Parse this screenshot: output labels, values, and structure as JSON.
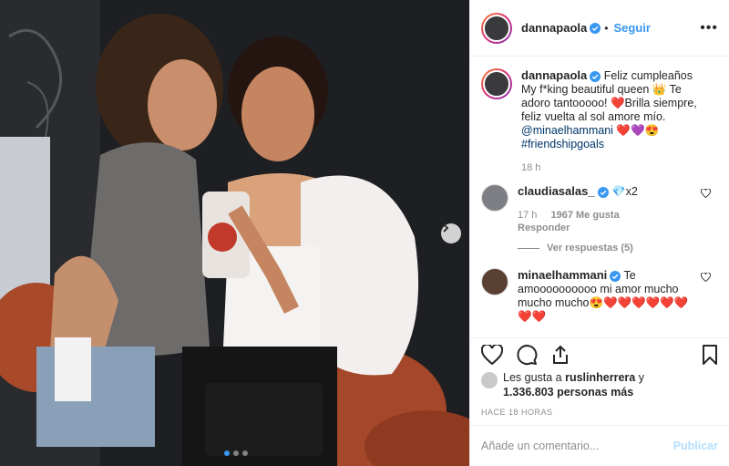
{
  "post": {
    "author": "dannapaola",
    "follow_label": "Seguir",
    "more_label": "•••",
    "caption": {
      "username": "dannapaola",
      "text_1": " Feliz cumpleaños My f*king beautiful queen 👑 Te adoro tantooooo! ❤️Brilla siempre, feliz vuelta al sol amore mío. ",
      "mention": "@minaelhammani",
      "text_2": " ❤️💜😍 ",
      "hashtag": "#friendshipgoals",
      "time": "18 h"
    },
    "comments": [
      {
        "username": "claudiasalas_",
        "text": " 💎x2",
        "time": "17 h",
        "likes": "1967 Me gusta",
        "reply": "Responder",
        "view_replies": "Ver respuestas (5)"
      },
      {
        "username": "minaelhammani",
        "text": " Te amoooooooooo mi amor mucho mucho mucho😍❤️❤️❤️❤️❤️❤️❤️❤️"
      }
    ],
    "likes_text_1": "Les gusta a ",
    "likes_user": "ruslinherrera",
    "likes_text_2": " y ",
    "likes_count": "1.336.803 personas más",
    "timestamp": "HACE 18 HORAS",
    "comment_placeholder": "Añade un comentario...",
    "publish_label": "Publicar",
    "carousel": {
      "slides": 3,
      "active": 0
    }
  },
  "colors": {
    "link": "#3897f0",
    "verified": "#3897f0",
    "muted": "#8e8e8e"
  }
}
